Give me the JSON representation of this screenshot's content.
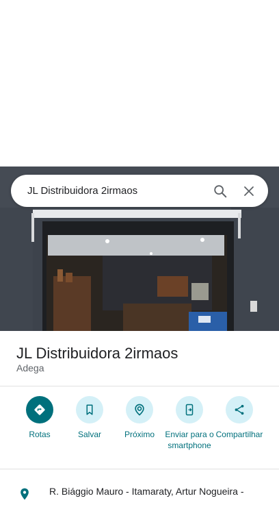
{
  "search": {
    "query": "JL Distribuidora 2irmaos"
  },
  "place": {
    "name": "JL Distribuidora 2irmaos",
    "category": "Adega"
  },
  "actions": [
    {
      "label": "Rotas",
      "icon": "directions-icon"
    },
    {
      "label": "Salvar",
      "icon": "bookmark-icon"
    },
    {
      "label": "Próximo",
      "icon": "nearby-icon"
    },
    {
      "label": "Enviar para o smartphone",
      "icon": "send-to-phone-icon"
    },
    {
      "label": "Compartilhar",
      "icon": "share-icon"
    }
  ],
  "address": {
    "text": "R. Biággio Mauro - Itamaraty, Artur Nogueira -"
  },
  "colors": {
    "accent": "#00707c",
    "accent_light": "#d4f0f7",
    "text": "#202124",
    "subtext": "#5f6368"
  }
}
